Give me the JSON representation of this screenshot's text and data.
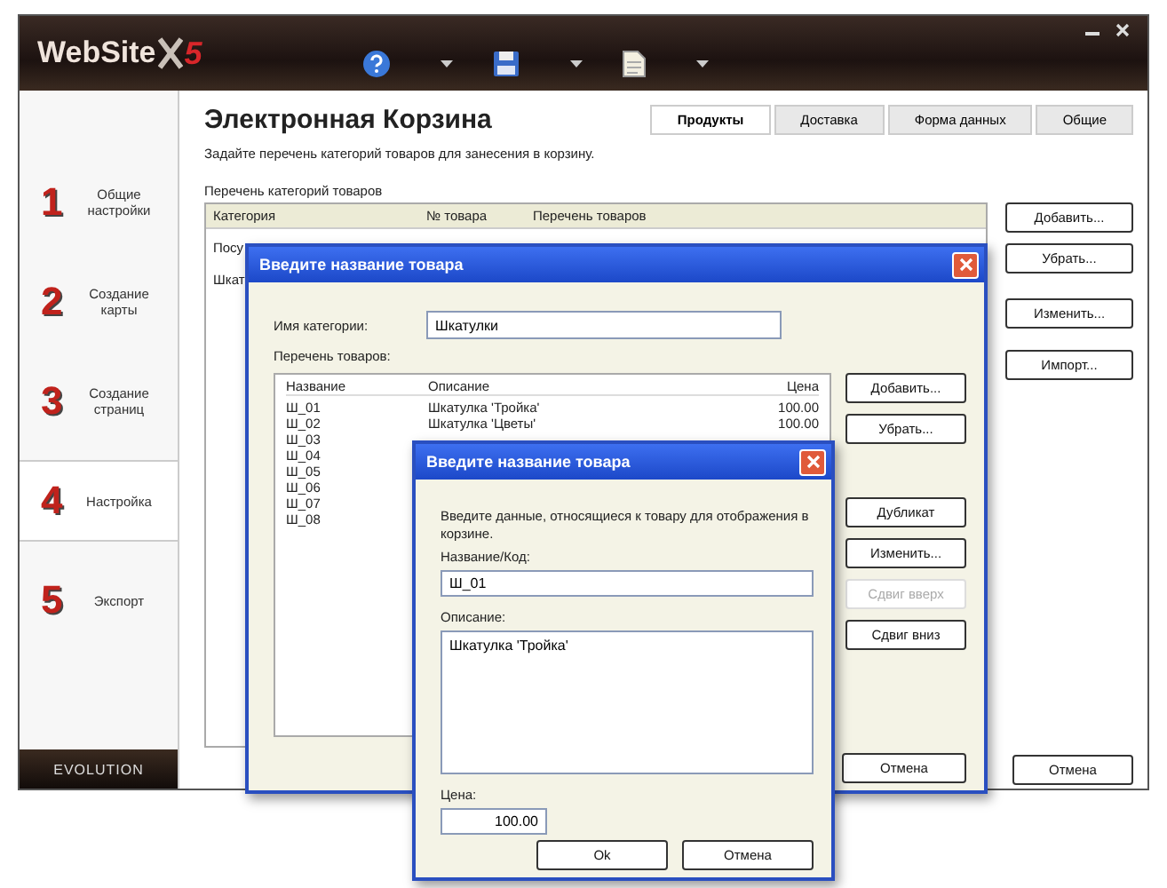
{
  "app": {
    "logo": "WebSite",
    "logo_version": "5",
    "edition": "EVOLUTION"
  },
  "toolbar": [
    {
      "kind": "help"
    },
    {
      "kind": "save"
    },
    {
      "kind": "document"
    }
  ],
  "sidebar": {
    "items": [
      {
        "number": "1",
        "label": "Общие настройки",
        "selected": false
      },
      {
        "number": "2",
        "label": "Создание карты",
        "selected": false
      },
      {
        "number": "3",
        "label": "Создание страниц",
        "selected": false
      },
      {
        "number": "4",
        "label": "Настройка",
        "selected": true
      },
      {
        "number": "5",
        "label": "Экспорт",
        "selected": false
      }
    ]
  },
  "page": {
    "title": "Электронная Корзина",
    "tabs": [
      {
        "label": "Продукты",
        "selected": true
      },
      {
        "label": "Доставка",
        "selected": false
      },
      {
        "label": "Форма данных",
        "selected": false
      },
      {
        "label": "Общие",
        "selected": false
      }
    ],
    "description": "Задайте перечень категорий товаров для занесения в корзину.",
    "list_label": "Перечень категорий товаров",
    "columns": [
      "Категория",
      "№ товара",
      "Перечень товаров"
    ],
    "rows": [
      "Посу",
      "Шкат"
    ],
    "buttons": [
      "Добавить...",
      "Убрать...",
      "Изменить...",
      "Импорт..."
    ],
    "cancel": "Отмена"
  },
  "category_dialog": {
    "title": "Введите название товара",
    "name_label": "Имя категории:",
    "name_value": "Шкатулки",
    "list_label": "Перечень товаров:",
    "columns": [
      "Название",
      "Описание",
      "Цена"
    ],
    "rows": [
      {
        "name": "Ш_01",
        "description": "Шкатулка 'Тройка'",
        "price": "100.00"
      },
      {
        "name": "Ш_02",
        "description": "Шкатулка 'Цветы'",
        "price": "100.00"
      },
      {
        "name": "Ш_03"
      },
      {
        "name": "Ш_04"
      },
      {
        "name": "Ш_05"
      },
      {
        "name": "Ш_06"
      },
      {
        "name": "Ш_07"
      },
      {
        "name": "Ш_08"
      }
    ],
    "buttons": [
      {
        "label": "Добавить...",
        "disabled": false
      },
      {
        "label": "Убрать...",
        "disabled": false
      },
      {
        "label": "Дубликат",
        "disabled": false
      },
      {
        "label": "Изменить...",
        "disabled": false
      },
      {
        "label": "Сдвиг вверх",
        "disabled": true
      },
      {
        "label": "Сдвиг вниз",
        "disabled": false
      }
    ],
    "cancel": "Отмена"
  },
  "item_dialog": {
    "title": "Введите название товара",
    "intro": "Введите данные, относящиеся к товару для отображения в корзине.",
    "code_label": "Название/Код:",
    "code_value": "Ш_01",
    "description_label": "Описание:",
    "description_value": "Шкатулка 'Тройка'",
    "price_label": "Цена:",
    "price_value": "100.00",
    "ok": "Ok",
    "cancel": "Отмена"
  }
}
